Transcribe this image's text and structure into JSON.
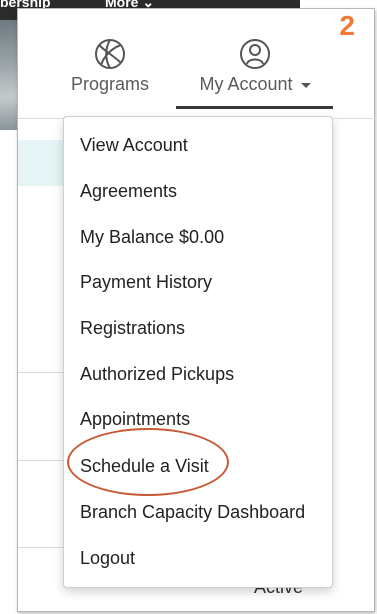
{
  "background": {
    "top_strip_left": "bership",
    "top_strip_more": "More",
    "status": "Active"
  },
  "step_number": "2",
  "nav": {
    "programs": {
      "label": "Programs",
      "icon": "basketball-icon"
    },
    "account": {
      "label": "My Account",
      "icon": "user-avatar-icon"
    }
  },
  "menu": {
    "items": [
      "View Account",
      "Agreements",
      "My Balance $0.00",
      "Payment History",
      "Registrations",
      "Authorized Pickups",
      "Appointments",
      "Schedule a Visit",
      "Branch Capacity Dashboard",
      "Logout"
    ],
    "highlighted": "Schedule a Visit"
  },
  "colors": {
    "step_number": "#f07b34",
    "highlight_oval": "#c85a35",
    "underline": "#3a3a3a"
  }
}
